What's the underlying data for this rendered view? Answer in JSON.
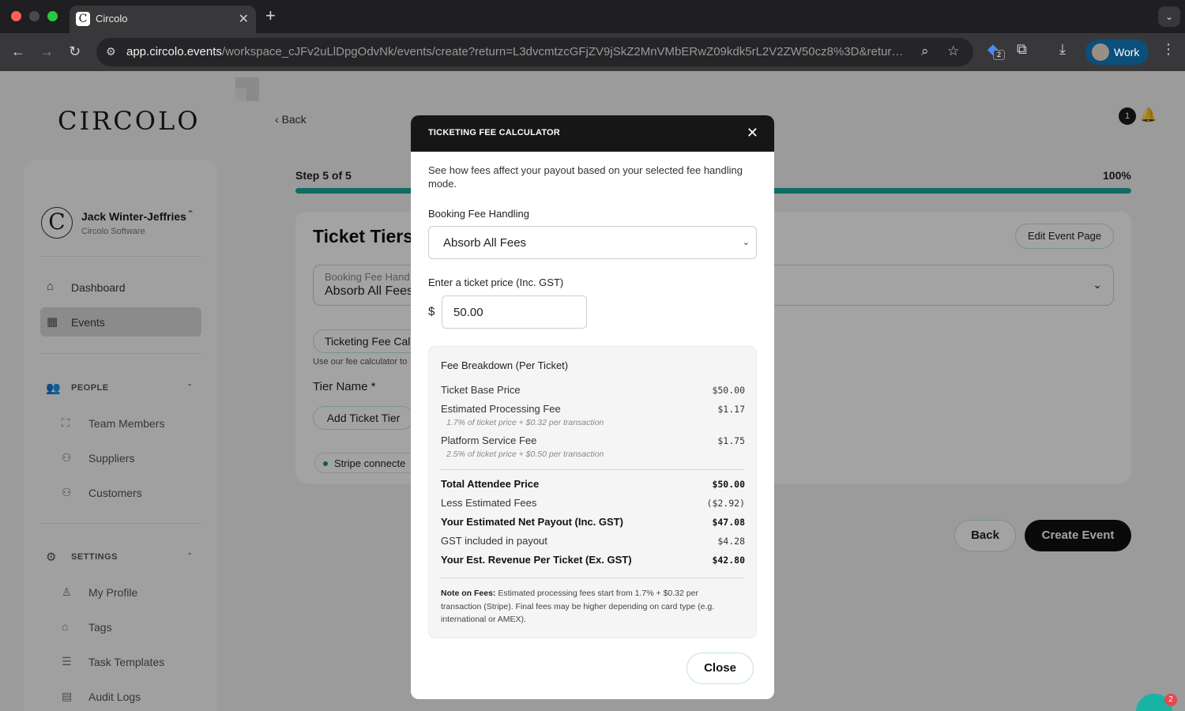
{
  "browser": {
    "tab_title": "Circolo",
    "url_host": "app.circolo.events",
    "url_path": "/workspace_cJFv2uLlDpgOdvNk/events/create?return=L3dvcmtzcGFjZV9jSkZ2MnVMbERwZ09kdk5rL2V2ZW50cz8%3D&retur…",
    "extension_badge": "2",
    "profile_label": "Work"
  },
  "app": {
    "logo": "CIRCOLO",
    "back_label": "Back",
    "notification_count": "1",
    "chat_badge": "2"
  },
  "sidebar": {
    "user_name": "Jack Winter-Jeffries",
    "user_org": "Circolo Software",
    "nav": [
      {
        "label": "Dashboard",
        "icon": "home-icon"
      },
      {
        "label": "Events",
        "icon": "calendar-icon",
        "active": true
      }
    ],
    "people_header": "PEOPLE",
    "people_items": [
      {
        "label": "Team Members",
        "icon": "org-chart-icon"
      },
      {
        "label": "Suppliers",
        "icon": "user-group-icon"
      },
      {
        "label": "Customers",
        "icon": "user-group-icon"
      }
    ],
    "settings_header": "SETTINGS",
    "settings_items": [
      {
        "label": "My Profile",
        "icon": "user-icon"
      },
      {
        "label": "Tags",
        "icon": "tag-icon"
      },
      {
        "label": "Task Templates",
        "icon": "list-icon"
      },
      {
        "label": "Audit Logs",
        "icon": "table-icon"
      }
    ]
  },
  "wizard": {
    "step_label": "Step 5 of 5",
    "percent_label": "100%",
    "progress": 1.0,
    "card_title": "Ticket Tiers",
    "edit_event_page": "Edit Event Page",
    "select_label": "Booking Fee Hand",
    "select_value": "Absorb All Fees",
    "calc_pill": "Ticketing Fee Calc",
    "calc_help": "Use our fee calculator to",
    "tier_name_label": "Tier Name *",
    "add_tier": "Add Ticket Tier",
    "stripe_status": "Stripe connecte",
    "back_button": "Back",
    "create_button": "Create Event"
  },
  "modal": {
    "title": "TICKETING FEE CALCULATOR",
    "intro": "See how fees affect your payout based on your selected fee handling mode.",
    "fee_handling_label": "Booking Fee Handling",
    "fee_handling_value": "Absorb All Fees",
    "price_label": "Enter a ticket price (Inc. GST)",
    "currency_symbol": "$",
    "price_value": "50.00",
    "breakdown_title": "Fee Breakdown (Per Ticket)",
    "rows": {
      "base_price": {
        "label": "Ticket Base Price",
        "value": "$50.00"
      },
      "processing": {
        "label": "Estimated Processing Fee",
        "value": "$1.17",
        "note": "1.7% of ticket price + $0.32 per transaction"
      },
      "platform": {
        "label": "Platform Service Fee",
        "value": "$1.75",
        "note": "2.5% of ticket price + $0.50 per transaction"
      },
      "total_attendee": {
        "label": "Total Attendee Price",
        "value": "$50.00"
      },
      "less_fees": {
        "label": "Less Estimated Fees",
        "value": "($2.92)"
      },
      "net_payout": {
        "label": "Your Estimated Net Payout (Inc. GST)",
        "value": "$47.08"
      },
      "gst": {
        "label": "GST included in payout",
        "value": "$4.28"
      },
      "revenue_ex_gst": {
        "label": "Your Est. Revenue Per Ticket (Ex. GST)",
        "value": "$42.80"
      }
    },
    "note_heading": "Note on Fees:",
    "note_text": "Estimated processing fees start from 1.7% + $0.32 per transaction (Stripe). Final fees may be higher depending on card type (e.g. international or AMEX).",
    "close_button": "Close"
  }
}
